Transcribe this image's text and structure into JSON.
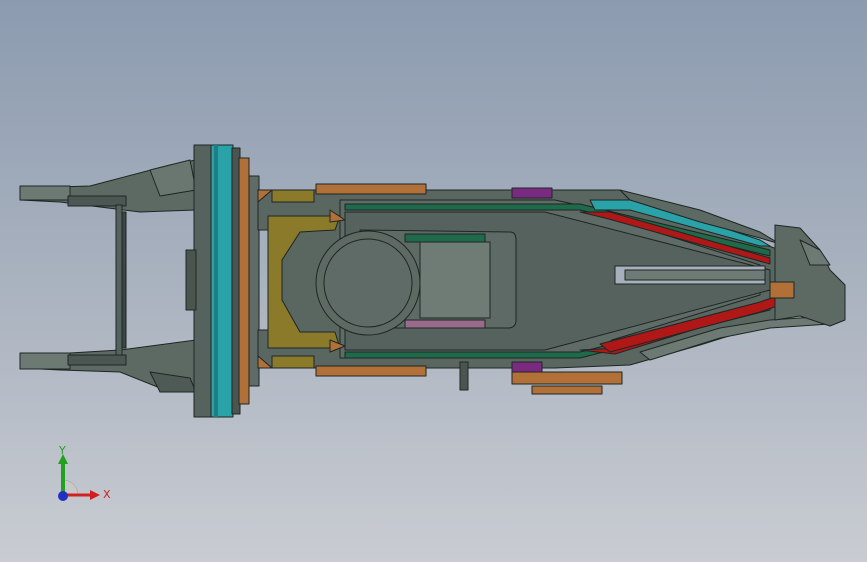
{
  "viewport": {
    "background_top": "#8c9bb0",
    "background_bottom": "#c9ccd2"
  },
  "triad": {
    "x_label": "X",
    "y_label": "Y",
    "x_color": "#d02020",
    "y_color": "#22a022",
    "z_color": "#2030c0"
  },
  "model": {
    "body_color": "#5a6660",
    "edge_color": "#1e2624",
    "flange_color": "#2aa3a8",
    "bronze_color": "#b07038",
    "olive_color": "#8a7a2a",
    "purple_color": "#7a2a80",
    "red_color": "#b01818",
    "green_color": "#1f6a4a",
    "pink_color": "#9a6a8a"
  }
}
